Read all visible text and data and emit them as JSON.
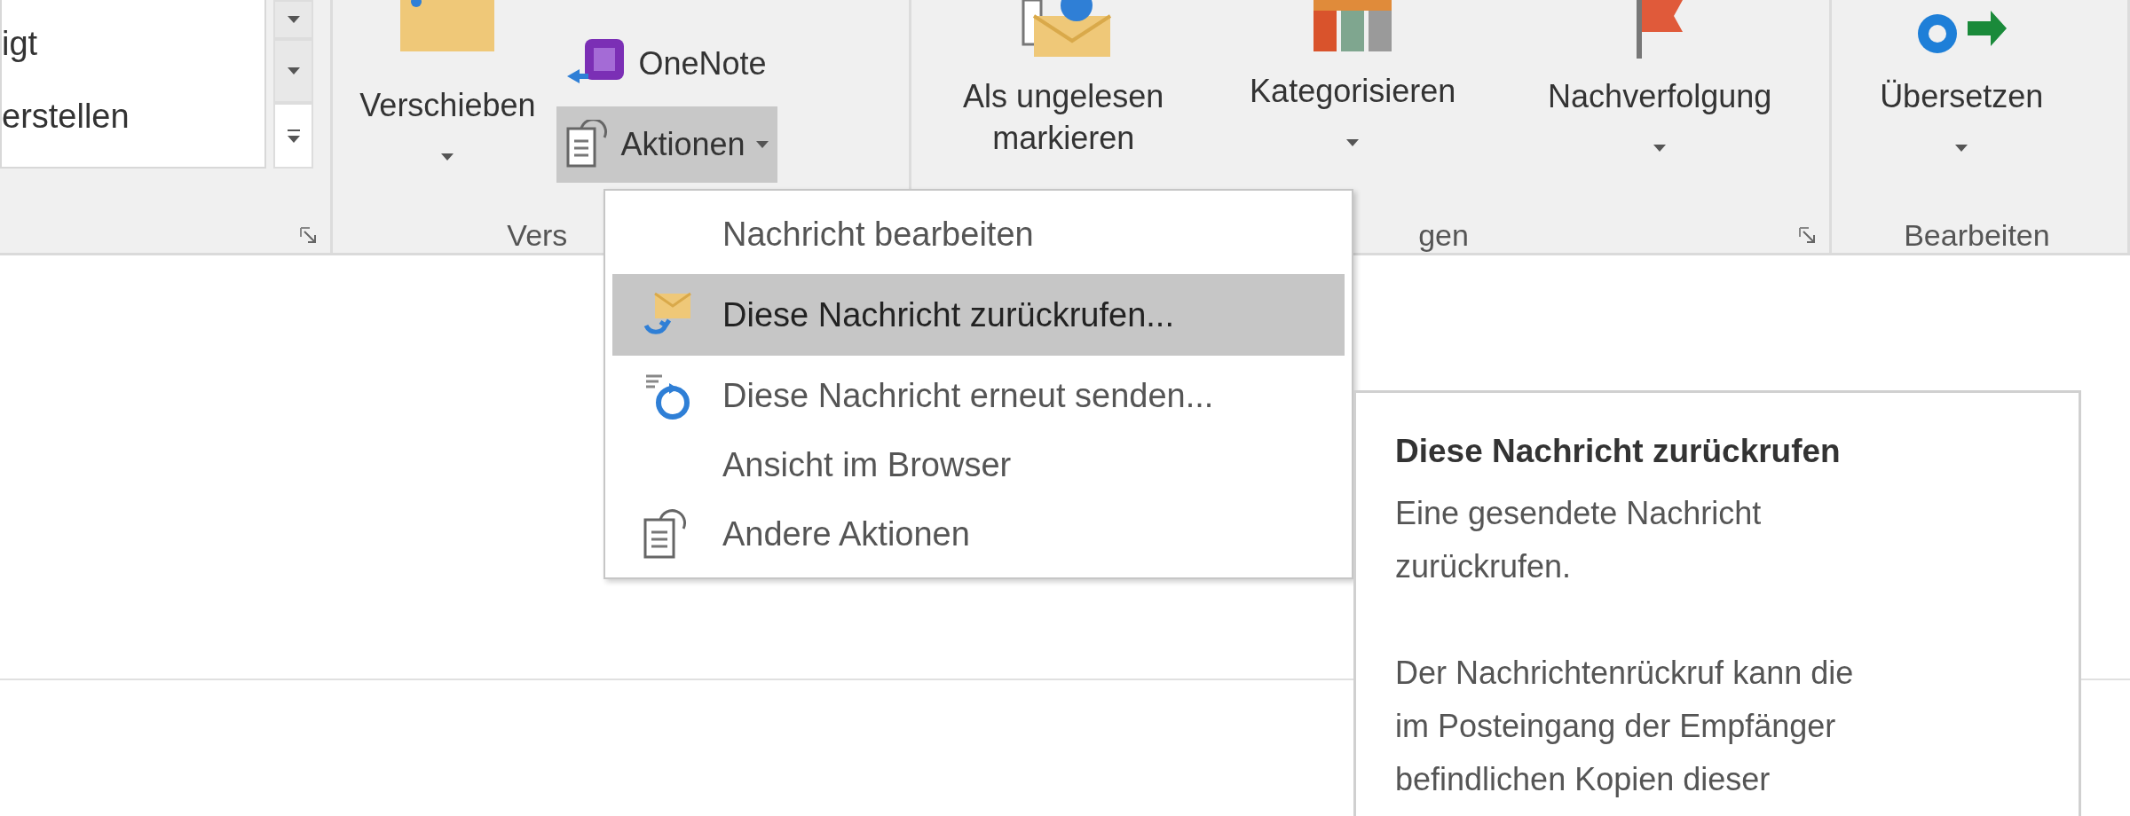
{
  "gallery": {
    "items": [
      {
        "label": "igt"
      },
      {
        "label": "erstellen"
      }
    ]
  },
  "groups": [
    {
      "launcher": true
    },
    {
      "label": "Vers",
      "launcher": false,
      "buttons": [
        {
          "kind": "large",
          "label": "Verschieben",
          "dropdown": true,
          "pressed": false
        },
        {
          "kind": "small",
          "label": "OneNote",
          "dropdown": false,
          "pressed": false
        },
        {
          "kind": "small",
          "label": "Aktionen",
          "dropdown": true,
          "pressed": true
        }
      ]
    },
    {
      "label": "gen",
      "launcher": true,
      "buttons": [
        {
          "kind": "large",
          "label": "Als ungelesen markieren",
          "dropdown": false,
          "pressed": false
        },
        {
          "kind": "large",
          "label": "Kategorisieren",
          "dropdown": true,
          "pressed": false
        },
        {
          "kind": "large",
          "label": "Nachverfolgung",
          "dropdown": true,
          "pressed": false
        }
      ]
    },
    {
      "label": "Bearbeiten",
      "launcher": false,
      "buttons": [
        {
          "kind": "large",
          "label": "Übersetzen",
          "dropdown": true,
          "pressed": false
        }
      ]
    }
  ],
  "menu": {
    "items": [
      {
        "label": "Nachricht bearbeiten",
        "selected": false
      },
      {
        "label": "Diese Nachricht zurückrufen...",
        "selected": true
      },
      {
        "label": "Diese Nachricht erneut senden...",
        "selected": false
      },
      {
        "label": "Ansicht im Browser",
        "selected": false
      },
      {
        "label": "Andere Aktionen",
        "selected": false
      }
    ]
  },
  "tooltip": {
    "title": "Diese Nachricht zurückrufen",
    "paragraphs": [
      "Eine gesendete Nachricht zurückrufen.",
      "Der Nachrichtenrückruf kann die im Posteingang der Empfänger befindlichen Kopien dieser"
    ]
  }
}
